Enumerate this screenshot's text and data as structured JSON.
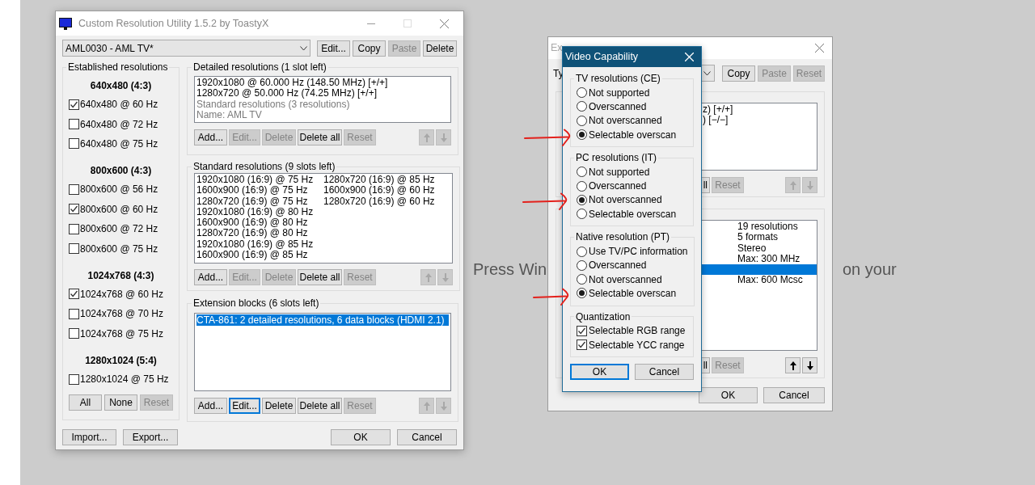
{
  "desktop_text": [
    "Press Win",
    "on your"
  ],
  "main_window": {
    "title": "Custom Resolution Utility 1.5.2 by ToastyX",
    "device": "AML0030 - AML TV*",
    "top_buttons": [
      {
        "label": "Edit...",
        "disabled": false
      },
      {
        "label": "Copy",
        "disabled": false
      },
      {
        "label": "Paste",
        "disabled": true
      },
      {
        "label": "Delete",
        "disabled": false
      }
    ],
    "established": {
      "title": "Established resolutions",
      "groups": [
        {
          "heading": "640x480 (4:3)",
          "items": [
            {
              "label": "640x480 @ 60 Hz",
              "checked": true
            },
            {
              "label": "640x480 @ 72 Hz",
              "checked": false
            },
            {
              "label": "640x480 @ 75 Hz",
              "checked": false
            }
          ]
        },
        {
          "heading": "800x600 (4:3)",
          "items": [
            {
              "label": "800x600 @ 56 Hz",
              "checked": false
            },
            {
              "label": "800x600 @ 60 Hz",
              "checked": true
            },
            {
              "label": "800x600 @ 72 Hz",
              "checked": false
            },
            {
              "label": "800x600 @ 75 Hz",
              "checked": false
            }
          ]
        },
        {
          "heading": "1024x768 (4:3)",
          "items": [
            {
              "label": "1024x768 @ 60 Hz",
              "checked": true
            },
            {
              "label": "1024x768 @ 70 Hz",
              "checked": false
            },
            {
              "label": "1024x768 @ 75 Hz",
              "checked": false
            }
          ]
        },
        {
          "heading": "1280x1024 (5:4)",
          "items": [
            {
              "label": "1280x1024 @ 75 Hz",
              "checked": false
            }
          ]
        }
      ],
      "buttons": [
        {
          "label": "All",
          "disabled": false
        },
        {
          "label": "None",
          "disabled": false
        },
        {
          "label": "Reset",
          "disabled": true
        }
      ]
    },
    "detailed": {
      "title": "Detailed resolutions (1 slot left)",
      "rows": [
        {
          "text": "1920x1080 @ 60.000 Hz (148.50 MHz) [+/+]",
          "dim": false
        },
        {
          "text": "1280x720 @ 50.000 Hz (74.25 MHz) [+/+]",
          "dim": false
        },
        {
          "text": "Standard resolutions (3 resolutions)",
          "dim": true
        },
        {
          "text": "Name: AML TV",
          "dim": true
        }
      ],
      "buttons": [
        {
          "label": "Add...",
          "disabled": false
        },
        {
          "label": "Edit...",
          "disabled": true
        },
        {
          "label": "Delete",
          "disabled": true
        },
        {
          "label": "Delete all",
          "disabled": false
        },
        {
          "label": "Reset",
          "disabled": true
        }
      ],
      "move_buttons": [
        {
          "disabled": true
        },
        {
          "disabled": true
        }
      ]
    },
    "standard": {
      "title": "Standard resolutions (9 slots left)",
      "columns": [
        [
          "1920x1080 (16:9) @ 75 Hz",
          "1600x900 (16:9) @ 75 Hz",
          "1280x720 (16:9) @ 75 Hz",
          "1920x1080 (16:9) @ 80 Hz",
          "1600x900 (16:9) @ 80 Hz",
          "1280x720 (16:9) @ 80 Hz",
          "1920x1080 (16:9) @ 85 Hz",
          "1600x900 (16:9) @ 85 Hz"
        ],
        [
          "1280x720 (16:9) @ 85 Hz",
          "1600x900 (16:9) @ 60 Hz",
          "1280x720 (16:9) @ 60 Hz"
        ]
      ],
      "buttons": [
        {
          "label": "Add...",
          "disabled": false
        },
        {
          "label": "Edit...",
          "disabled": true
        },
        {
          "label": "Delete",
          "disabled": true
        },
        {
          "label": "Delete all",
          "disabled": false
        },
        {
          "label": "Reset",
          "disabled": true
        }
      ],
      "move_buttons": [
        {
          "disabled": true
        },
        {
          "disabled": true
        }
      ]
    },
    "extension": {
      "title": "Extension blocks (6 slots left)",
      "rows": [
        {
          "text": "CTA-861: 2 detailed resolutions, 6 data blocks (HDMI 2.1)",
          "selected": true
        }
      ],
      "buttons": [
        {
          "label": "Add...",
          "disabled": false,
          "focused": false
        },
        {
          "label": "Edit...",
          "disabled": false,
          "focused": true
        },
        {
          "label": "Delete",
          "disabled": false,
          "focused": false
        },
        {
          "label": "Delete all",
          "disabled": false,
          "focused": false
        },
        {
          "label": "Reset",
          "disabled": true,
          "focused": false
        }
      ],
      "move_buttons": [
        {
          "disabled": true
        },
        {
          "disabled": true
        }
      ]
    },
    "bottom_left_buttons": [
      {
        "label": "Import...",
        "disabled": false
      },
      {
        "label": "Export...",
        "disabled": false
      }
    ],
    "bottom_right_buttons": [
      {
        "label": "OK",
        "disabled": false
      },
      {
        "label": "Cancel",
        "disabled": false
      }
    ]
  },
  "extension_block_window": {
    "title": "Ex",
    "type_label": "Ty",
    "top_buttons": [
      {
        "label": "Copy",
        "disabled": false
      },
      {
        "label": "Paste",
        "disabled": true
      },
      {
        "label": "Reset",
        "disabled": true
      }
    ],
    "lists": [
      {
        "rows": [
          {
            "text": "z) [+/+]",
            "selected": false
          },
          {
            "text": ") [−/−]",
            "selected": false
          }
        ],
        "buttons": [
          {
            "label": "ll",
            "disabled": false
          },
          {
            "label": "Reset",
            "disabled": true
          }
        ],
        "move_buttons": [
          {
            "disabled": true
          },
          {
            "disabled": true
          }
        ]
      },
      {
        "rows": [
          {
            "text": "19 resolutions",
            "selected": false
          },
          {
            "text": "5 formats",
            "selected": false
          },
          {
            "text": "Stereo",
            "selected": false
          },
          {
            "text": "Max: 300 MHz",
            "selected": false
          },
          {
            "selected": true
          },
          {
            "text": "Max: 600 Mcsc",
            "selected": false
          }
        ],
        "buttons": [
          {
            "label": "ll",
            "disabled": false
          },
          {
            "label": "Reset",
            "disabled": true
          }
        ],
        "move_buttons": [
          {
            "disabled": false
          },
          {
            "disabled": false
          }
        ]
      }
    ],
    "bottom_buttons": [
      {
        "label": "OK",
        "disabled": false
      },
      {
        "label": "Cancel",
        "disabled": false
      }
    ]
  },
  "video_capability_dialog": {
    "title": "Video Capability",
    "groups": [
      {
        "title": "TV resolutions (CE)",
        "kind": "radio",
        "options": [
          {
            "label": "Not supported",
            "selected": false
          },
          {
            "label": "Overscanned",
            "selected": false
          },
          {
            "label": "Not overscanned",
            "selected": false
          },
          {
            "label": "Selectable overscan",
            "selected": true
          }
        ]
      },
      {
        "title": "PC resolutions (IT)",
        "kind": "radio",
        "options": [
          {
            "label": "Not supported",
            "selected": false
          },
          {
            "label": "Overscanned",
            "selected": false
          },
          {
            "label": "Not overscanned",
            "selected": true
          },
          {
            "label": "Selectable overscan",
            "selected": false
          }
        ]
      },
      {
        "title": "Native resolution (PT)",
        "kind": "radio",
        "options": [
          {
            "label": "Use TV/PC information",
            "selected": false
          },
          {
            "label": "Overscanned",
            "selected": false
          },
          {
            "label": "Not overscanned",
            "selected": false
          },
          {
            "label": "Selectable overscan",
            "selected": true
          }
        ]
      },
      {
        "title": "Quantization",
        "kind": "checkbox",
        "options": [
          {
            "label": "Selectable RGB range",
            "checked": true
          },
          {
            "label": "Selectable YCC range",
            "checked": true
          }
        ]
      }
    ],
    "buttons": [
      {
        "label": "OK",
        "focused": true
      },
      {
        "label": "Cancel",
        "focused": false
      }
    ]
  }
}
